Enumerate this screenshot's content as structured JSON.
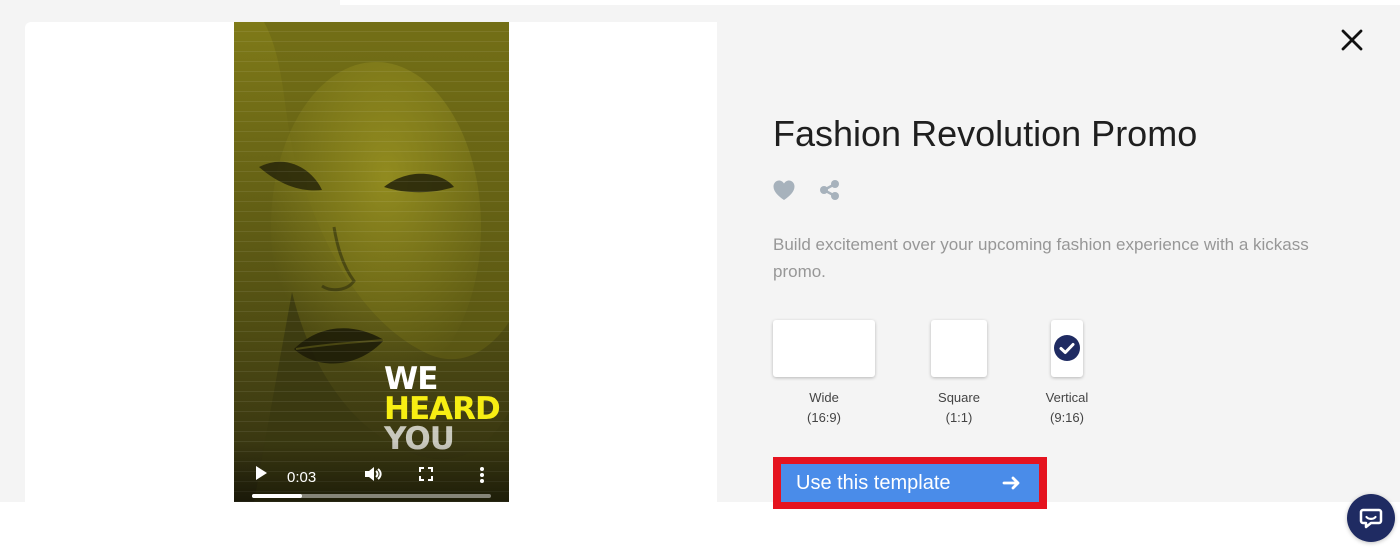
{
  "colors": {
    "page_background": "#f4f4f4",
    "modal_left_background": "#ffffff",
    "video_tint": "#6d6a12",
    "heading_yellow": "#f7ee13",
    "icon_gray": "#a7b2bc",
    "check_navy": "#1f2b62",
    "cta_blue": "#4a8ce9",
    "cta_highlight_red": "#e5131f",
    "chat_navy": "#1f2b62"
  },
  "video": {
    "overlay_lines": [
      "WE",
      "HEARD",
      "YOU"
    ],
    "current_time": "0:03",
    "progress_fraction": 0.21,
    "icons": {
      "play": "play-icon",
      "volume": "volume-icon",
      "fullscreen": "fullscreen-icon",
      "more": "more-vertical-icon"
    }
  },
  "modal": {
    "close_icon": "close-icon",
    "title": "Fashion Revolution Promo",
    "actions": {
      "favorite_icon": "heart-icon",
      "share_icon": "share-icon"
    },
    "description": "Build excitement over your upcoming fashion experience with a kickass promo."
  },
  "formats": [
    {
      "name": "Wide",
      "ratio": "(16:9)",
      "selected": false
    },
    {
      "name": "Square",
      "ratio": "(1:1)",
      "selected": false
    },
    {
      "name": "Vertical",
      "ratio": "(9:16)",
      "selected": true
    }
  ],
  "cta": {
    "label": "Use this template",
    "icon": "arrow-right-icon"
  },
  "chat": {
    "icon": "chat-icon"
  }
}
